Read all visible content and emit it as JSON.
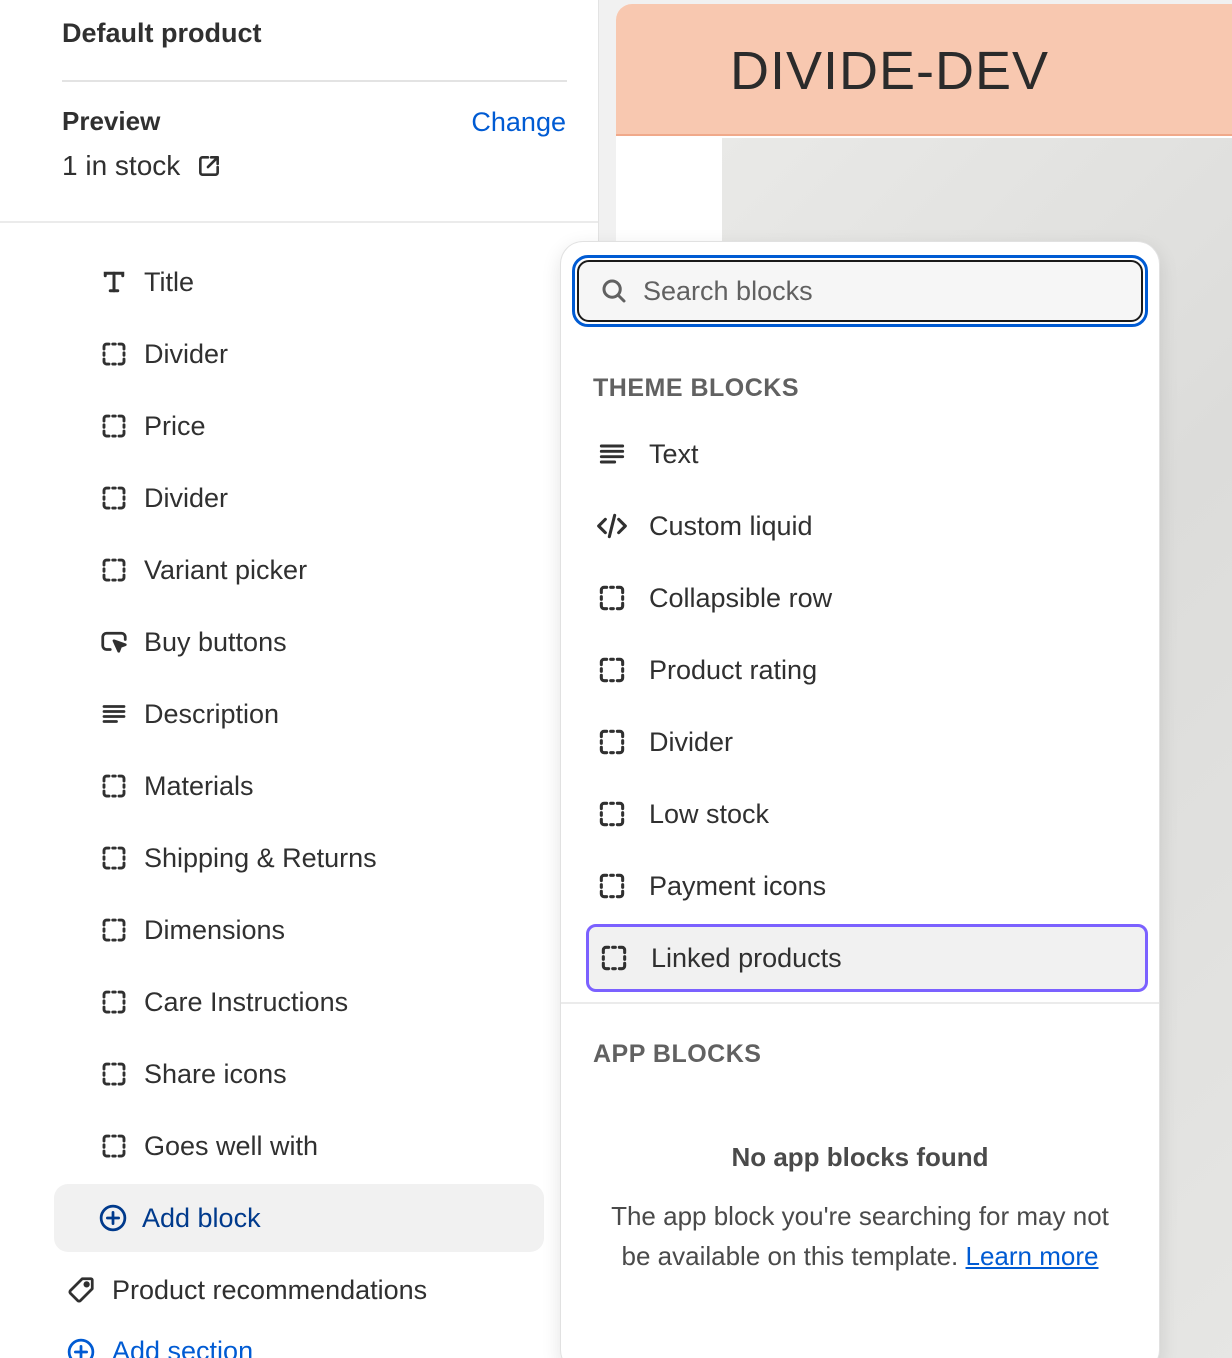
{
  "sidebar": {
    "title": "Default product",
    "preview_label": "Preview",
    "change_label": "Change",
    "stock_text": "1 in stock",
    "blocks": [
      {
        "label": "Title",
        "icon": "text-title-icon"
      },
      {
        "label": "Divider",
        "icon": "block-placeholder-icon"
      },
      {
        "label": "Price",
        "icon": "block-placeholder-icon"
      },
      {
        "label": "Divider",
        "icon": "block-placeholder-icon"
      },
      {
        "label": "Variant picker",
        "icon": "block-placeholder-icon"
      },
      {
        "label": "Buy buttons",
        "icon": "cursor-click-icon"
      },
      {
        "label": "Description",
        "icon": "text-lines-icon"
      },
      {
        "label": "Materials",
        "icon": "block-placeholder-icon"
      },
      {
        "label": "Shipping & Returns",
        "icon": "block-placeholder-icon"
      },
      {
        "label": "Dimensions",
        "icon": "block-placeholder-icon"
      },
      {
        "label": "Care Instructions",
        "icon": "block-placeholder-icon"
      },
      {
        "label": "Share icons",
        "icon": "block-placeholder-icon"
      },
      {
        "label": "Goes well with",
        "icon": "block-placeholder-icon"
      }
    ],
    "add_block_label": "Add block",
    "product_recommendations_label": "Product recommendations",
    "add_section_label": "Add section"
  },
  "store_preview": {
    "store_name": "DIVIDE-DEV",
    "header_color": "#f8c8b0"
  },
  "picker": {
    "search_placeholder": "Search blocks",
    "theme_blocks_heading": "THEME BLOCKS",
    "theme_blocks": [
      {
        "label": "Text",
        "icon": "text-lines-icon"
      },
      {
        "label": "Custom liquid",
        "icon": "code-icon"
      },
      {
        "label": "Collapsible row",
        "icon": "block-placeholder-icon"
      },
      {
        "label": "Product rating",
        "icon": "block-placeholder-icon"
      },
      {
        "label": "Divider",
        "icon": "block-placeholder-icon"
      },
      {
        "label": "Low stock",
        "icon": "block-placeholder-icon"
      },
      {
        "label": "Payment icons",
        "icon": "block-placeholder-icon"
      },
      {
        "label": "Linked products",
        "icon": "block-placeholder-icon",
        "selected": true
      }
    ],
    "app_blocks_heading": "APP BLOCKS",
    "empty_title": "No app blocks found",
    "empty_text": "The app block you're searching for may not be available on this template.",
    "learn_more_label": "Learn more"
  },
  "colors": {
    "link_blue": "#005bd3",
    "focus_purple": "#7b61ff",
    "add_block_text": "#003a8c"
  }
}
